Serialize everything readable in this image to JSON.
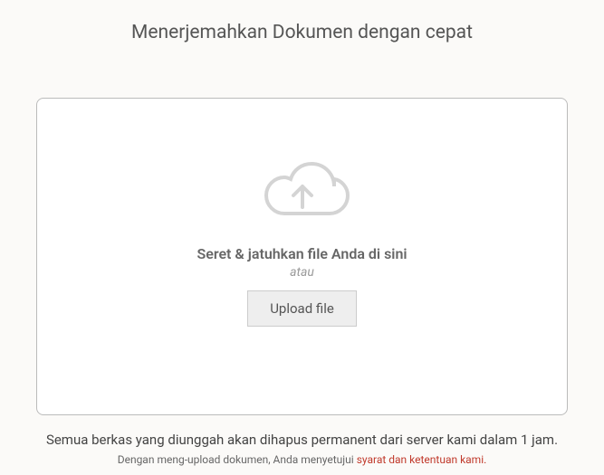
{
  "header": {
    "title": "Menerjemahkan Dokumen dengan cepat"
  },
  "dropzone": {
    "drop_text": "Seret & jatuhkan file Anda di sini",
    "or_text": "atau",
    "upload_button_label": "Upload file"
  },
  "footer": {
    "deletion_notice": "Semua berkas yang diunggah akan dihapus permanent dari server kami dalam 1 jam.",
    "terms_prefix": "Dengan meng-upload dokumen, Anda menyetujui ",
    "terms_link_text": "syarat dan ketentuan kami.",
    "terms_suffix": ""
  }
}
